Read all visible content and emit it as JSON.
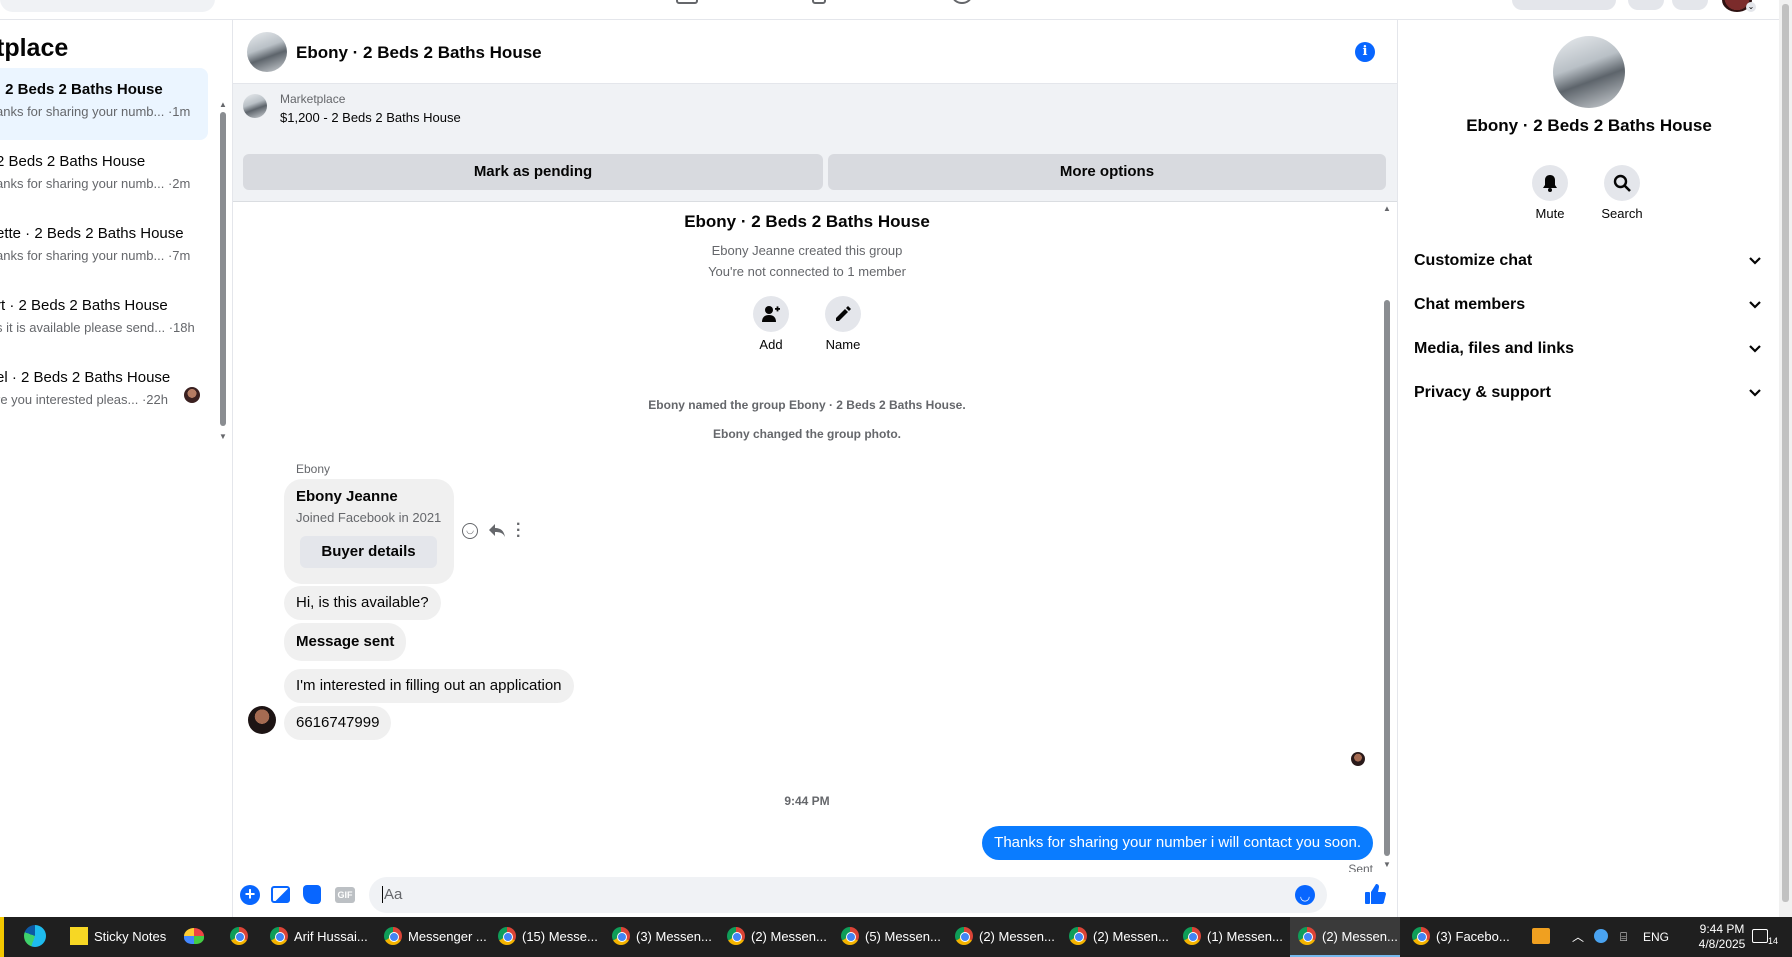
{
  "sidebar": {
    "title": "tplace",
    "conversations": [
      {
        "title": "· 2 Beds 2 Baths House",
        "snippet": "anks for sharing your numb... ·1m",
        "active": true
      },
      {
        "title": "2 Beds 2 Baths House",
        "snippet": "anks for sharing your numb... ·2m"
      },
      {
        "title": "ette · 2 Beds 2 Baths House",
        "snippet": "anks for sharing your numb... ·7m"
      },
      {
        "title": "rt · 2 Beds 2 Baths House",
        "snippet": "s it is available please send... ·18h"
      },
      {
        "title": "el · 2 Beds 2 Baths House",
        "snippet": "re you interested pleas... ·22h"
      }
    ]
  },
  "chat": {
    "title": "Ebony · 2 Beds 2 Baths House",
    "marketplace_label": "Marketplace",
    "listing": "$1,200 - 2 Beds 2 Baths House",
    "mark_pending": "Mark as pending",
    "more_options": "More options",
    "group_name": "Ebony · 2 Beds 2 Baths House",
    "created": "Ebony Jeanne created this group",
    "not_connected": "You're not connected to 1 member",
    "add_label": "Add",
    "name_label": "Name",
    "sys1": "Ebony named the group Ebony · 2 Beds 2 Baths House.",
    "sys2": "Ebony changed the group photo.",
    "sender": "Ebony",
    "card_name": "Ebony Jeanne",
    "card_joined": "Joined Facebook in 2021",
    "buyer_details": "Buyer details",
    "msg1": "Hi, is this available?",
    "msg2": "Message sent",
    "msg3": "I'm interested in filling out an application",
    "msg4": "6616747999",
    "time": "9:44 PM",
    "my_msg": "Thanks for sharing your number i will contact you soon.",
    "status": "Sent",
    "composer_placeholder": "Aa"
  },
  "right": {
    "title": "Ebony · 2 Beds 2 Baths House",
    "mute": "Mute",
    "search": "Search",
    "sections": [
      "Customize chat",
      "Chat members",
      "Media, files and links",
      "Privacy & support"
    ]
  },
  "taskbar": {
    "items": [
      "Sticky Notes",
      "Arif Hussai...",
      "Messenger ...",
      "(15) Messe...",
      "(3) Messen...",
      "(2) Messen...",
      "(5) Messen...",
      "(2) Messen...",
      "(2) Messen...",
      "(1) Messen...",
      "(2) Messen...",
      "(3) Facebo..."
    ],
    "lang": "ENG",
    "time": "9:44 PM",
    "date": "4/8/2025",
    "notifications": "14"
  },
  "colors": {
    "accent": "#0866ff",
    "bubble_me": "#0a7cff",
    "bubble_them": "#f0f0f0"
  }
}
